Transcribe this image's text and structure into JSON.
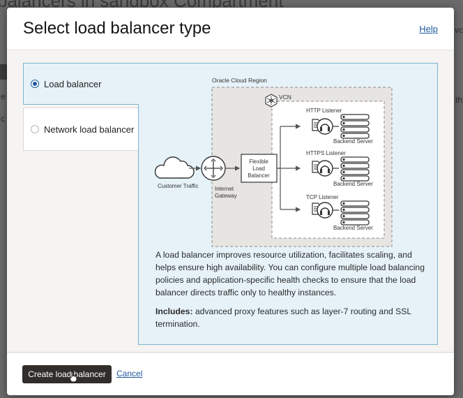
{
  "background": {
    "heading_fragment": "balancers in sandbox Compartment",
    "left_fragment_1": "e",
    "left_fragment_2": "c",
    "right_fragment_1": "vc",
    "right_fragment_2": "th"
  },
  "modal": {
    "title": "Select load balancer type",
    "help_label": "Help"
  },
  "options": [
    {
      "label": "Load balancer",
      "selected": true
    },
    {
      "label": "Network load balancer",
      "selected": false
    }
  ],
  "diagram": {
    "region_label": "Oracle Cloud Region",
    "vcn_label": "VCN",
    "customer_traffic_label": "Customer Traffic",
    "gateway_label_line1": "Internet",
    "gateway_label_line2": "Gateway",
    "lb_label_line1": "Flexible",
    "lb_label_line2": "Load",
    "lb_label_line3": "Balancer",
    "listeners": [
      {
        "label": "HTTP Listener",
        "server_label": "Backend Server"
      },
      {
        "label": "HTTPS Listener",
        "server_label": "Backend Server"
      },
      {
        "label": "TCP Listener",
        "server_label": "Backend Server"
      }
    ]
  },
  "description": {
    "text": "A load balancer improves resource utilization, facilitates scaling, and helps ensure high availability. You can configure multiple load balancing policies and application-specific health checks to ensure that the load balancer directs traffic only to healthy instances.",
    "includes_label": "Includes:",
    "includes_text": " advanced proxy features such as layer-7 routing and SSL termination."
  },
  "footer": {
    "create_label": "Create load balancer",
    "cancel_label": "Cancel"
  },
  "colors": {
    "selected_tile_bg": "#e6f2f8",
    "selected_border": "#7fb3cf",
    "link": "#1f5a9e",
    "primary_button": "#312d2a"
  }
}
